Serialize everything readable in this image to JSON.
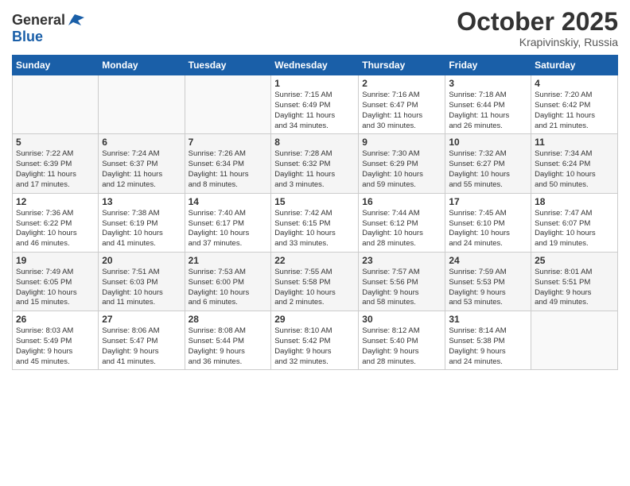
{
  "header": {
    "logo_general": "General",
    "logo_blue": "Blue",
    "month_title": "October 2025",
    "location": "Krapivinskiy, Russia"
  },
  "weekdays": [
    "Sunday",
    "Monday",
    "Tuesday",
    "Wednesday",
    "Thursday",
    "Friday",
    "Saturday"
  ],
  "weeks": [
    [
      {
        "day": "",
        "info": ""
      },
      {
        "day": "",
        "info": ""
      },
      {
        "day": "",
        "info": ""
      },
      {
        "day": "1",
        "info": "Sunrise: 7:15 AM\nSunset: 6:49 PM\nDaylight: 11 hours\nand 34 minutes."
      },
      {
        "day": "2",
        "info": "Sunrise: 7:16 AM\nSunset: 6:47 PM\nDaylight: 11 hours\nand 30 minutes."
      },
      {
        "day": "3",
        "info": "Sunrise: 7:18 AM\nSunset: 6:44 PM\nDaylight: 11 hours\nand 26 minutes."
      },
      {
        "day": "4",
        "info": "Sunrise: 7:20 AM\nSunset: 6:42 PM\nDaylight: 11 hours\nand 21 minutes."
      }
    ],
    [
      {
        "day": "5",
        "info": "Sunrise: 7:22 AM\nSunset: 6:39 PM\nDaylight: 11 hours\nand 17 minutes."
      },
      {
        "day": "6",
        "info": "Sunrise: 7:24 AM\nSunset: 6:37 PM\nDaylight: 11 hours\nand 12 minutes."
      },
      {
        "day": "7",
        "info": "Sunrise: 7:26 AM\nSunset: 6:34 PM\nDaylight: 11 hours\nand 8 minutes."
      },
      {
        "day": "8",
        "info": "Sunrise: 7:28 AM\nSunset: 6:32 PM\nDaylight: 11 hours\nand 3 minutes."
      },
      {
        "day": "9",
        "info": "Sunrise: 7:30 AM\nSunset: 6:29 PM\nDaylight: 10 hours\nand 59 minutes."
      },
      {
        "day": "10",
        "info": "Sunrise: 7:32 AM\nSunset: 6:27 PM\nDaylight: 10 hours\nand 55 minutes."
      },
      {
        "day": "11",
        "info": "Sunrise: 7:34 AM\nSunset: 6:24 PM\nDaylight: 10 hours\nand 50 minutes."
      }
    ],
    [
      {
        "day": "12",
        "info": "Sunrise: 7:36 AM\nSunset: 6:22 PM\nDaylight: 10 hours\nand 46 minutes."
      },
      {
        "day": "13",
        "info": "Sunrise: 7:38 AM\nSunset: 6:19 PM\nDaylight: 10 hours\nand 41 minutes."
      },
      {
        "day": "14",
        "info": "Sunrise: 7:40 AM\nSunset: 6:17 PM\nDaylight: 10 hours\nand 37 minutes."
      },
      {
        "day": "15",
        "info": "Sunrise: 7:42 AM\nSunset: 6:15 PM\nDaylight: 10 hours\nand 33 minutes."
      },
      {
        "day": "16",
        "info": "Sunrise: 7:44 AM\nSunset: 6:12 PM\nDaylight: 10 hours\nand 28 minutes."
      },
      {
        "day": "17",
        "info": "Sunrise: 7:45 AM\nSunset: 6:10 PM\nDaylight: 10 hours\nand 24 minutes."
      },
      {
        "day": "18",
        "info": "Sunrise: 7:47 AM\nSunset: 6:07 PM\nDaylight: 10 hours\nand 19 minutes."
      }
    ],
    [
      {
        "day": "19",
        "info": "Sunrise: 7:49 AM\nSunset: 6:05 PM\nDaylight: 10 hours\nand 15 minutes."
      },
      {
        "day": "20",
        "info": "Sunrise: 7:51 AM\nSunset: 6:03 PM\nDaylight: 10 hours\nand 11 minutes."
      },
      {
        "day": "21",
        "info": "Sunrise: 7:53 AM\nSunset: 6:00 PM\nDaylight: 10 hours\nand 6 minutes."
      },
      {
        "day": "22",
        "info": "Sunrise: 7:55 AM\nSunset: 5:58 PM\nDaylight: 10 hours\nand 2 minutes."
      },
      {
        "day": "23",
        "info": "Sunrise: 7:57 AM\nSunset: 5:56 PM\nDaylight: 9 hours\nand 58 minutes."
      },
      {
        "day": "24",
        "info": "Sunrise: 7:59 AM\nSunset: 5:53 PM\nDaylight: 9 hours\nand 53 minutes."
      },
      {
        "day": "25",
        "info": "Sunrise: 8:01 AM\nSunset: 5:51 PM\nDaylight: 9 hours\nand 49 minutes."
      }
    ],
    [
      {
        "day": "26",
        "info": "Sunrise: 8:03 AM\nSunset: 5:49 PM\nDaylight: 9 hours\nand 45 minutes."
      },
      {
        "day": "27",
        "info": "Sunrise: 8:06 AM\nSunset: 5:47 PM\nDaylight: 9 hours\nand 41 minutes."
      },
      {
        "day": "28",
        "info": "Sunrise: 8:08 AM\nSunset: 5:44 PM\nDaylight: 9 hours\nand 36 minutes."
      },
      {
        "day": "29",
        "info": "Sunrise: 8:10 AM\nSunset: 5:42 PM\nDaylight: 9 hours\nand 32 minutes."
      },
      {
        "day": "30",
        "info": "Sunrise: 8:12 AM\nSunset: 5:40 PM\nDaylight: 9 hours\nand 28 minutes."
      },
      {
        "day": "31",
        "info": "Sunrise: 8:14 AM\nSunset: 5:38 PM\nDaylight: 9 hours\nand 24 minutes."
      },
      {
        "day": "",
        "info": ""
      }
    ]
  ]
}
